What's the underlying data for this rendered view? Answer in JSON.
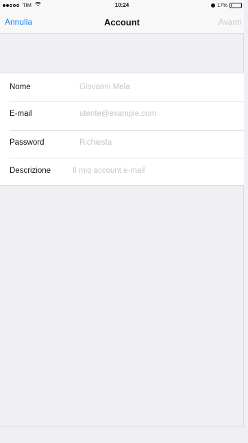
{
  "status_bar": {
    "carrier": "TIM",
    "time": "10:24",
    "battery_percent": "17%",
    "battery_level": 0.17
  },
  "nav": {
    "left": "Annulla",
    "title": "Account",
    "right": "Avanti"
  },
  "form": {
    "rows": [
      {
        "label": "Nome",
        "placeholder": "Giovanni Mela"
      },
      {
        "label": "E-mail",
        "placeholder": "utente@example.com"
      },
      {
        "label": "Password",
        "placeholder": "Richiesta"
      },
      {
        "label": "Descrizione",
        "placeholder": "Il mio account e-mail"
      }
    ]
  },
  "colors": {
    "accent": "#1a7ef2",
    "disabled": "#c8c8cc",
    "placeholder": "#c6c6cb",
    "background": "#efeff4",
    "battery_low": "#e23b3b"
  },
  "icons": {
    "signal": "signal-dots-icon",
    "wifi": "wifi-icon",
    "do_not_disturb": "moon-icon",
    "battery": "battery-icon"
  }
}
